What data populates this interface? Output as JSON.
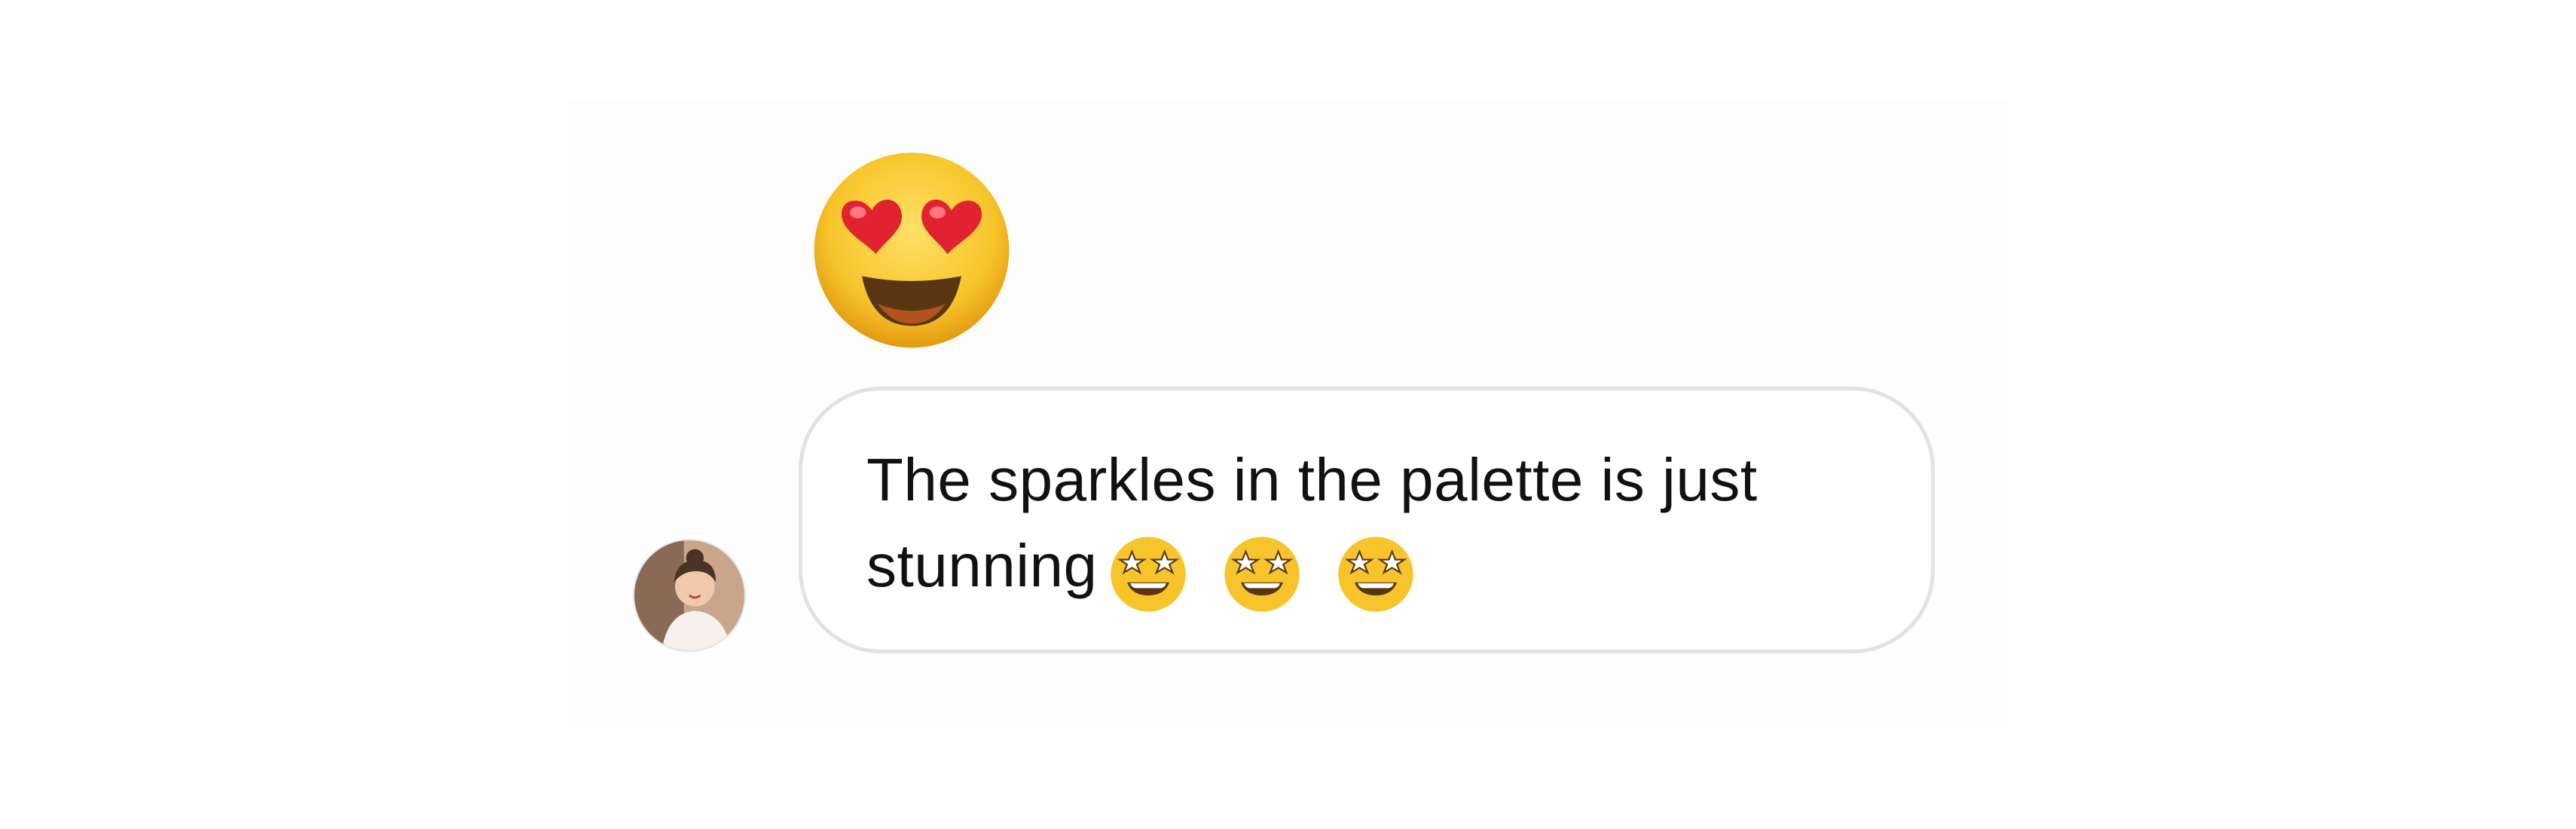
{
  "conversation": {
    "reaction": {
      "icon": "heart-eyes-emoji-icon"
    },
    "message": {
      "text": "The sparkles in the palette is just stunning",
      "emojis": [
        "star-struck-emoji-icon",
        "star-struck-emoji-icon",
        "star-struck-emoji-icon"
      ]
    },
    "sender": {
      "avatar": "avatar-photo"
    }
  },
  "colors": {
    "panel_background": "#fdfdfd",
    "bubble_border": "#e2e2e2",
    "text": "#111111"
  }
}
